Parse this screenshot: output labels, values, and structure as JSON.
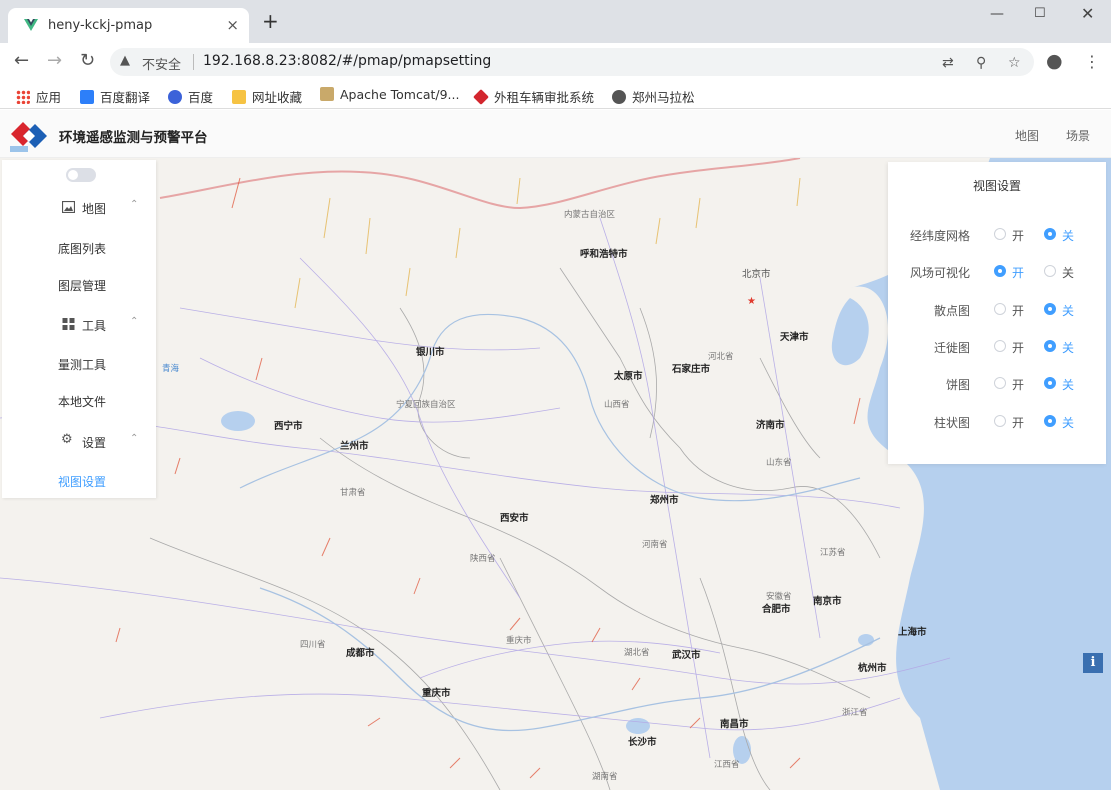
{
  "browser": {
    "tab_title": "heny-kckj-pmap",
    "new_tab": "+",
    "close_tab": "×",
    "insecure_label": "不安全",
    "url": "192.168.8.23:8082/#/pmap/pmapsetting",
    "bookmarks": [
      "应用",
      "百度翻译",
      "百度",
      "网址收藏",
      "Apache Tomcat/9...",
      "外租车辆审批系统",
      "郑州马拉松"
    ]
  },
  "header": {
    "title": "环境遥感监测与预警平台",
    "map_types": [
      "地图",
      "场景"
    ]
  },
  "sidebar": {
    "groups": [
      {
        "label": "地图",
        "icon": "image-icon",
        "items": [
          "底图列表",
          "图层管理"
        ]
      },
      {
        "label": "工具",
        "icon": "grid-icon",
        "items": [
          "量测工具",
          "本地文件"
        ]
      },
      {
        "label": "设置",
        "icon": "gear-icon",
        "items": [
          "视图设置"
        ]
      }
    ]
  },
  "panel": {
    "title": "视图设置",
    "on_label": "开",
    "off_label": "关",
    "rows": [
      {
        "label": "经纬度网格",
        "value": "关"
      },
      {
        "label": "风场可视化",
        "value": "开"
      },
      {
        "label": "散点图",
        "value": "关"
      },
      {
        "label": "迁徙图",
        "value": "关"
      },
      {
        "label": "饼图",
        "value": "关"
      },
      {
        "label": "柱状图",
        "value": "关"
      }
    ]
  },
  "map": {
    "cities": [
      "呼和浩特市",
      "北京市",
      "天津市",
      "银川市",
      "太原市",
      "石家庄市",
      "西宁市",
      "兰州市",
      "济南市",
      "郑州市",
      "西安市",
      "合肥市",
      "南京市",
      "上海市",
      "成都市",
      "武汉市",
      "杭州市",
      "重庆市",
      "长沙市",
      "南昌市"
    ],
    "provinces": [
      "内蒙古自治区",
      "宁夏回族自治区",
      "山西省",
      "河北省",
      "甘肃省",
      "山东省",
      "陕西省",
      "河南省",
      "江苏省",
      "安徽省",
      "四川省",
      "湖北省",
      "重庆市",
      "浙江省",
      "湖南省",
      "江西省",
      "青海"
    ]
  },
  "info_button": "i",
  "colors": {
    "accent": "#409eff",
    "sea": "#b6d0ee",
    "land": "#f4f2ee"
  }
}
